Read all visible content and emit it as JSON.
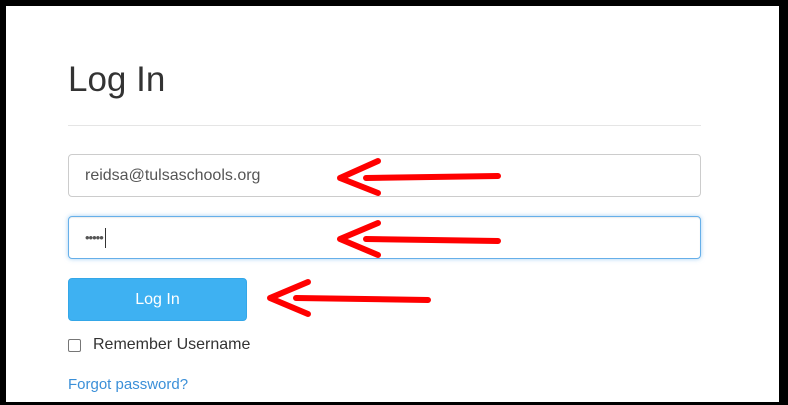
{
  "login": {
    "title": "Log In",
    "email_value": "reidsa@tulsaschools.org",
    "password_masked": "•••••",
    "submit_label": "Log In",
    "remember_label": "Remember Username",
    "remember_checked": false,
    "forgot_label": "Forgot password?"
  },
  "colors": {
    "button": "#3eb1f2",
    "link": "#3a8fd8",
    "annotation_arrow": "#ff0000",
    "focus_border": "#66afe9"
  },
  "annotations": {
    "arrow_icon": "left-arrow-icon",
    "count": 3
  }
}
